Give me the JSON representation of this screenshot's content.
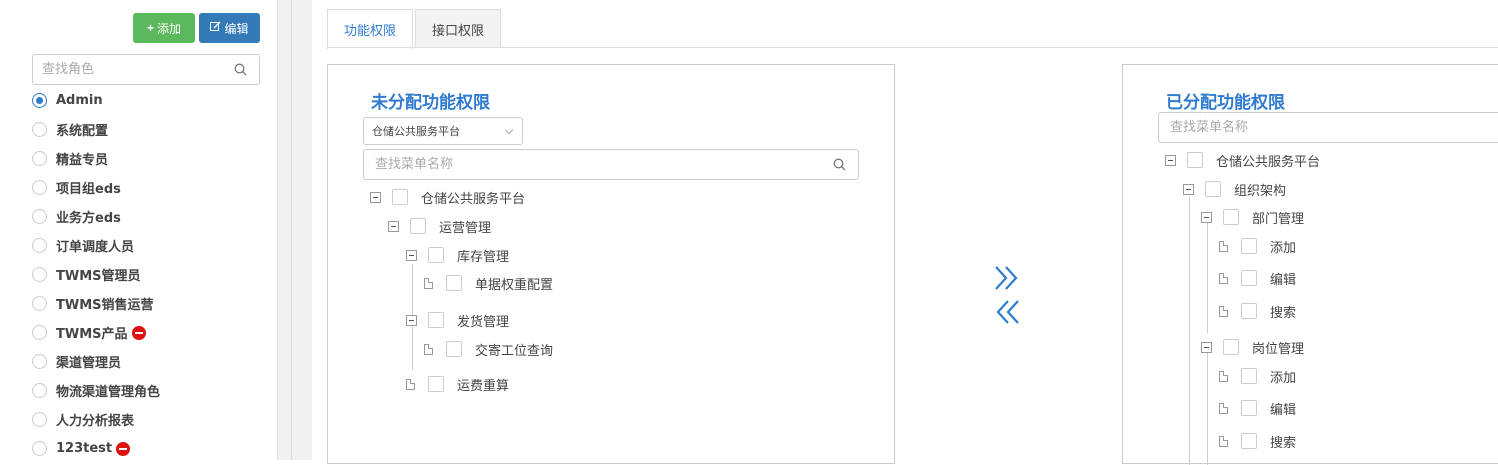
{
  "toolbar": {
    "add_label": "添加",
    "edit_label": "编辑"
  },
  "role_search": {
    "placeholder": "查找角色"
  },
  "roles": [
    {
      "label": "Admin",
      "selected": true,
      "badge": false
    },
    {
      "label": "系统配置",
      "selected": false,
      "badge": false
    },
    {
      "label": "精益专员",
      "selected": false,
      "badge": false
    },
    {
      "label": "项目组eds",
      "selected": false,
      "badge": false
    },
    {
      "label": "业务方eds",
      "selected": false,
      "badge": false
    },
    {
      "label": "订单调度人员",
      "selected": false,
      "badge": false
    },
    {
      "label": "TWMS管理员",
      "selected": false,
      "badge": false
    },
    {
      "label": "TWMS销售运营",
      "selected": false,
      "badge": false
    },
    {
      "label": "TWMS产品",
      "selected": false,
      "badge": true
    },
    {
      "label": "渠道管理员",
      "selected": false,
      "badge": false
    },
    {
      "label": "物流渠道管理角色",
      "selected": false,
      "badge": false
    },
    {
      "label": "人力分析报表",
      "selected": false,
      "badge": false
    },
    {
      "label": "123test",
      "selected": false,
      "badge": true
    }
  ],
  "tabs": [
    {
      "label": "功能权限",
      "active": true
    },
    {
      "label": "接口权限",
      "active": false
    }
  ],
  "unassigned": {
    "title": "未分配功能权限",
    "select_value": "仓储公共服务平台",
    "search_placeholder": "查找菜单名称",
    "nodes": [
      {
        "label": "仓储公共服务平台",
        "type": "folder"
      },
      {
        "label": "运营管理",
        "type": "folder"
      },
      {
        "label": "库存管理",
        "type": "folder"
      },
      {
        "label": "单据权重配置",
        "type": "file"
      },
      {
        "label": "发货管理",
        "type": "folder"
      },
      {
        "label": "交寄工位查询",
        "type": "file"
      },
      {
        "label": "运费重算",
        "type": "file"
      }
    ]
  },
  "assigned": {
    "title": "已分配功能权限",
    "search_placeholder": "查找菜单名称",
    "nodes": [
      {
        "label": "仓储公共服务平台",
        "type": "folder"
      },
      {
        "label": "组织架构",
        "type": "folder"
      },
      {
        "label": "部门管理",
        "type": "folder"
      },
      {
        "label": "添加",
        "type": "file"
      },
      {
        "label": "编辑",
        "type": "file"
      },
      {
        "label": "搜索",
        "type": "file"
      },
      {
        "label": "岗位管理",
        "type": "folder"
      },
      {
        "label": "添加",
        "type": "file"
      },
      {
        "label": "编辑",
        "type": "file"
      },
      {
        "label": "搜索",
        "type": "file"
      }
    ]
  },
  "colors": {
    "accent": "#2f7bd0",
    "add_button": "#5cb85c",
    "edit_button": "#337ab7",
    "badge": "#e01010"
  },
  "icons": {
    "move_right": "double-chevron-right-icon",
    "move_left": "double-chevron-left-icon"
  }
}
